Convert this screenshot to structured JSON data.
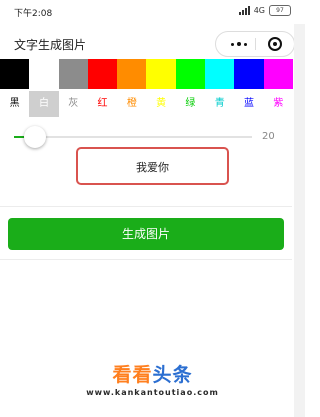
{
  "status_bar": {
    "time": "下午2:08",
    "network": "4G",
    "battery": "97"
  },
  "nav": {
    "title": "文字生成图片"
  },
  "palette": [
    {
      "name": "黑",
      "color": "#000000",
      "text_color": "#111111"
    },
    {
      "name": "白",
      "color": "#ffffff",
      "text_color": "#ffffff"
    },
    {
      "name": "灰",
      "color": "#8c8c8c",
      "text_color": "#8c8c8c"
    },
    {
      "name": "红",
      "color": "#ff0000",
      "text_color": "#ff0000"
    },
    {
      "name": "橙",
      "color": "#ff8c00",
      "text_color": "#ff8c00"
    },
    {
      "name": "黄",
      "color": "#ffff00",
      "text_color": "#ffff00"
    },
    {
      "name": "绿",
      "color": "#00ff00",
      "text_color": "#00cc00"
    },
    {
      "name": "青",
      "color": "#00ffff",
      "text_color": "#00cccc"
    },
    {
      "name": "蓝",
      "color": "#0000ff",
      "text_color": "#0000ff"
    },
    {
      "name": "紫",
      "color": "#ff00ff",
      "text_color": "#ff00ff"
    }
  ],
  "selected_color_index": 1,
  "font_size_slider": {
    "value": "20"
  },
  "text_input": {
    "value": "我爱你"
  },
  "generate_button": {
    "label": "生成图片"
  },
  "watermark": {
    "part1": "看看",
    "part2": "头条",
    "url": "www.kankantoutiao.com"
  },
  "colors": {
    "accent": "#1aad19",
    "highlight_border": "#d9534f"
  }
}
